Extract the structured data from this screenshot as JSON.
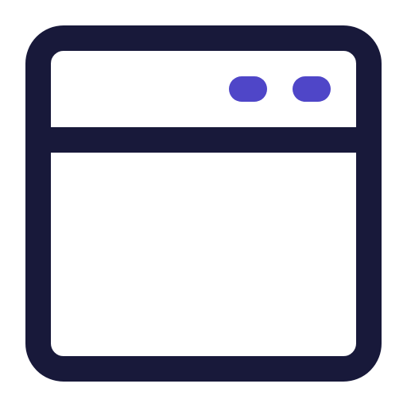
{
  "icon": {
    "name": "browser-window-icon",
    "colors": {
      "outline": "#18193a",
      "dots": "#4f46c8",
      "background": "#ffffff"
    },
    "control_dots": [
      "control-dot-1",
      "control-dot-2"
    ]
  }
}
